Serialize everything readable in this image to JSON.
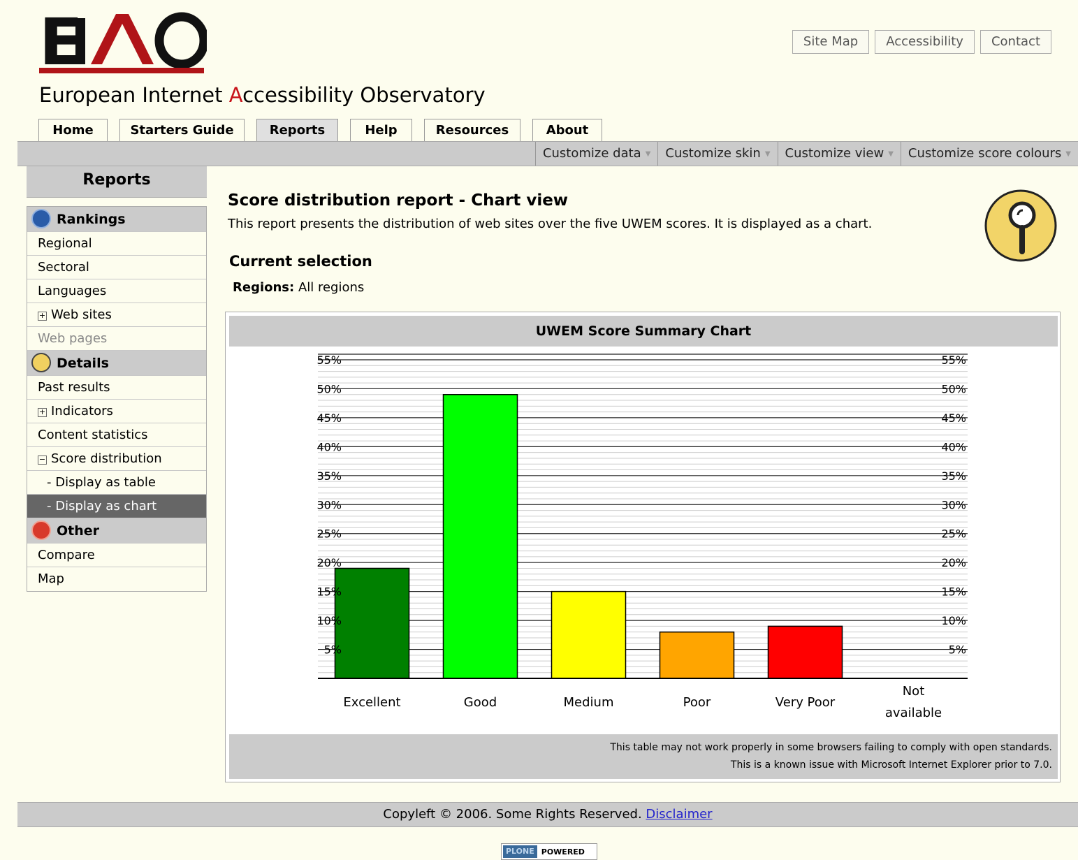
{
  "site": {
    "logo_text": "EIAO",
    "title_pre": "European Internet ",
    "title_hl": "A",
    "title_post": "ccessibility Observatory",
    "actions": [
      "Site Map",
      "Accessibility",
      "Contact"
    ]
  },
  "tabs": [
    "Home",
    "Starters Guide",
    "Reports",
    "Help",
    "Resources",
    "About"
  ],
  "active_tab": "Reports",
  "customize": [
    "Customize data",
    "Customize skin",
    "Customize view",
    "Customize score colours"
  ],
  "sidebar": {
    "heading": "Reports",
    "sections": {
      "rankings": "Rankings",
      "details": "Details",
      "other": "Other"
    },
    "items": {
      "regional": "Regional",
      "sectoral": "Sectoral",
      "languages": "Languages",
      "web_sites": "Web sites",
      "web_pages": "Web pages",
      "past_results": "Past results",
      "indicators": "Indicators",
      "content_statistics": "Content statistics",
      "score_distribution": "Score distribution",
      "display_table": "- Display as table",
      "display_chart": "- Display as chart",
      "compare": "Compare",
      "map": "Map"
    }
  },
  "main": {
    "title": "Score distribution report - Chart view",
    "description": "This report presents the distribution of web sites over the five UWEM scores. It is displayed as a chart.",
    "current_selection": "Current selection",
    "regions_label": "Regions:",
    "regions_value": " All regions"
  },
  "chart_data": {
    "type": "bar",
    "title": "UWEM Score Summary Chart",
    "categories": [
      "Excellent",
      "Good",
      "Medium",
      "Poor",
      "Very Poor",
      "Not available"
    ],
    "values": [
      19,
      49,
      15,
      8,
      9,
      0
    ],
    "colors": [
      "#008000",
      "#00ff00",
      "#ffff00",
      "#ffa500",
      "#ff0000",
      "#cccccc"
    ],
    "ylim": [
      0,
      55
    ],
    "yticks": [
      5,
      10,
      15,
      20,
      25,
      30,
      35,
      40,
      45,
      50,
      55
    ],
    "tick_suffix": "%",
    "grid": true
  },
  "chart_note": {
    "line1": "This table may not work properly in some browsers failing to comply with open standards.",
    "line2": "This is a known issue with Microsoft Internet Explorer prior to 7.0."
  },
  "footer": {
    "text": "Copyleft © 2006. Some Rights Reserved. ",
    "link": "Disclaimer"
  },
  "badge": {
    "left": "PLONE",
    "right": "POWERED"
  }
}
